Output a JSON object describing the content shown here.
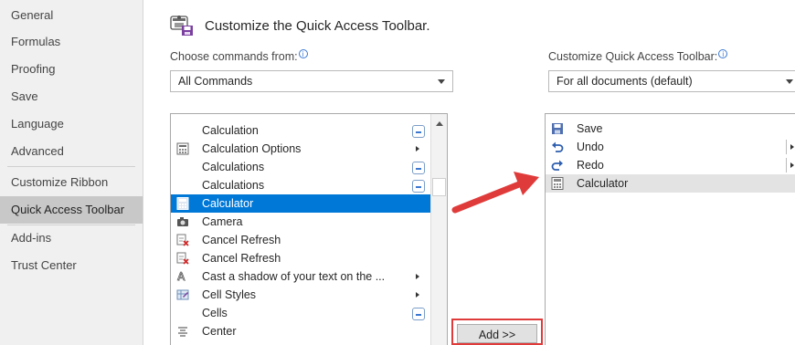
{
  "nav": {
    "items": [
      {
        "label": "General",
        "selected": false
      },
      {
        "label": "Formulas",
        "selected": false
      },
      {
        "label": "Proofing",
        "selected": false
      },
      {
        "label": "Save",
        "selected": false
      },
      {
        "label": "Language",
        "selected": false
      },
      {
        "label": "Advanced",
        "selected": false
      },
      {
        "label": "Customize Ribbon",
        "selected": false
      },
      {
        "label": "Quick Access Toolbar",
        "selected": true
      },
      {
        "label": "Add-ins",
        "selected": false
      },
      {
        "label": "Trust Center",
        "selected": false
      }
    ]
  },
  "header": {
    "title": "Customize the Quick Access Toolbar.",
    "icon": "qat-icon"
  },
  "choose": {
    "label": "Choose commands from:",
    "value": "All Commands"
  },
  "customize": {
    "label": "Customize Quick Access Toolbar:",
    "value": "For all documents (default)"
  },
  "commands": [
    {
      "label": "Calculation",
      "icon": "",
      "submenu": false,
      "dropdown": true,
      "selected": false
    },
    {
      "label": "Calculation Options",
      "icon": "calculation-options-icon",
      "submenu": true,
      "dropdown": false,
      "selected": false
    },
    {
      "label": "Calculations",
      "icon": "",
      "submenu": false,
      "dropdown": true,
      "selected": false
    },
    {
      "label": "Calculations",
      "icon": "",
      "submenu": false,
      "dropdown": true,
      "selected": false
    },
    {
      "label": "Calculator",
      "icon": "calculator-icon",
      "submenu": false,
      "dropdown": false,
      "selected": true
    },
    {
      "label": "Camera",
      "icon": "camera-icon",
      "submenu": false,
      "dropdown": false,
      "selected": false
    },
    {
      "label": "Cancel Refresh",
      "icon": "cancel-refresh-icon",
      "submenu": false,
      "dropdown": false,
      "selected": false
    },
    {
      "label": "Cancel Refresh",
      "icon": "cancel-refresh-icon",
      "submenu": false,
      "dropdown": false,
      "selected": false
    },
    {
      "label": "Cast a shadow of your text on the ...",
      "icon": "text-shadow-icon",
      "submenu": true,
      "dropdown": false,
      "selected": false
    },
    {
      "label": "Cell Styles",
      "icon": "cell-styles-icon",
      "submenu": true,
      "dropdown": false,
      "selected": false
    },
    {
      "label": "Cells",
      "icon": "",
      "submenu": false,
      "dropdown": true,
      "selected": false
    },
    {
      "label": "Center",
      "icon": "center-align-icon",
      "submenu": false,
      "dropdown": false,
      "selected": false
    }
  ],
  "toolbar_items": [
    {
      "label": "Save",
      "icon": "save-icon",
      "submenu": false,
      "highlight": false
    },
    {
      "label": "Undo",
      "icon": "undo-icon",
      "submenu": true,
      "highlight": false
    },
    {
      "label": "Redo",
      "icon": "redo-icon",
      "submenu": true,
      "highlight": false
    },
    {
      "label": "Calculator",
      "icon": "calculator-icon",
      "submenu": false,
      "highlight": true
    }
  ],
  "add_button": {
    "label": "Add >>"
  },
  "colors": {
    "selection": "#0078d7",
    "annotation": "#e03b3b",
    "nav_selected": "#c8c8c8"
  }
}
